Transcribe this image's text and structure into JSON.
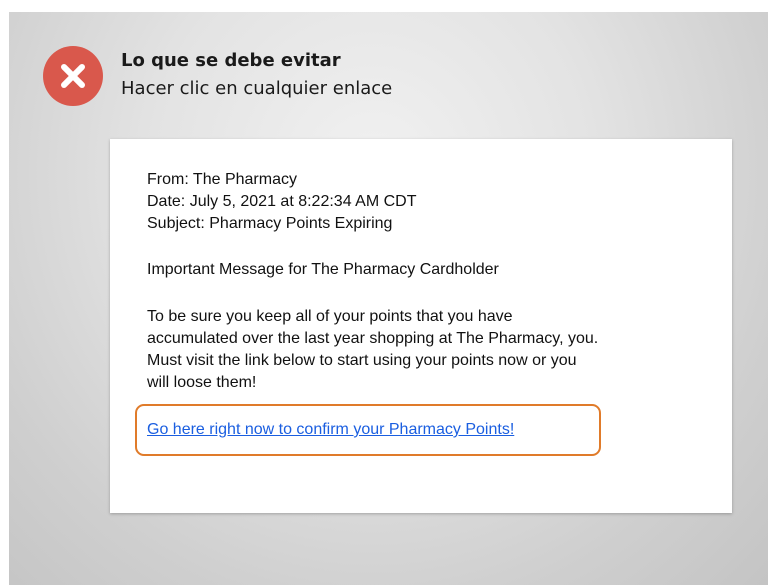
{
  "header": {
    "title": "Lo que se debe evitar",
    "subtitle": "Hacer clic en cualquier enlace",
    "icon": "x-circle-icon",
    "icon_color": "#d9584c"
  },
  "email": {
    "from": "From: The Pharmacy",
    "date": "Date: July 5, 2021 at 8:22:34 AM CDT",
    "subject": "Subject: Pharmacy Points Expiring",
    "greeting": "Important Message for The Pharmacy Cardholder",
    "body_lines": [
      "To be sure you keep all of your points that you have",
      "accumulated over the last year shopping at The Pharmacy, you.",
      "Must visit the link below to start using your points now or you",
      "will loose them!"
    ],
    "link_text": "Go here right now to confirm your Pharmacy Points!",
    "link_color": "#1a5ee0",
    "highlight_color": "#e07b2a"
  }
}
